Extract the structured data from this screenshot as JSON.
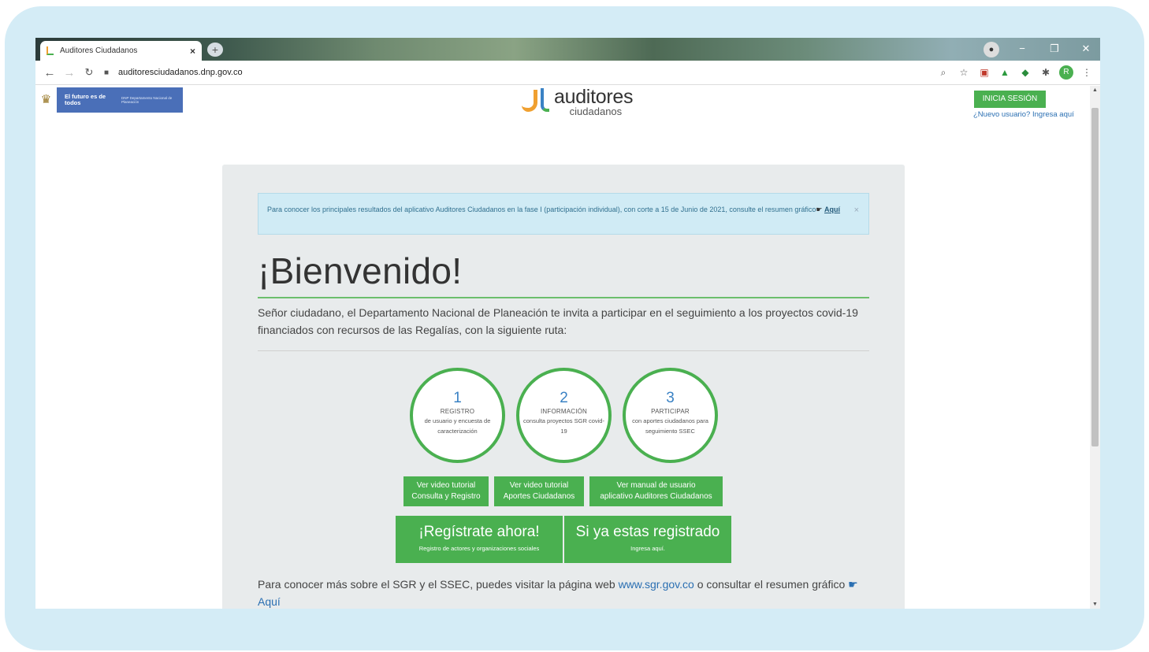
{
  "browser": {
    "tab_title": "Auditores Ciudadanos",
    "tab_close": "×",
    "new_tab": "+",
    "url": "auditoresciudadanos.dnp.gov.co",
    "window_controls": {
      "minimize": "−",
      "maximize": "❐",
      "close": "✕"
    },
    "extensions": [
      "zoom-icon",
      "star-icon",
      "pocket-icon",
      "drive-icon",
      "extension-icon",
      "puzzle-icon",
      "avatar",
      "menu-icon"
    ],
    "avatar_initial": "R"
  },
  "header": {
    "gov_tagline": "El futuro es de todos",
    "gov_dept": "DNP Departamento Nacional de Planeación",
    "brand_name": "auditores",
    "brand_sub": "ciudadanos",
    "login_label": "INICIA SESIÓN",
    "register_link": "¿Nuevo usuario? Ingresa aquí"
  },
  "alert": {
    "text": "Para conocer los principales resultados del aplicativo Auditores Ciudadanos en la fase I (participación individual), con corte a 15 de Junio de 2021, consulte el resumen gráfico",
    "link": "Aquí",
    "close": "×"
  },
  "main": {
    "welcome": "¡Bienvenido!",
    "intro": "Señor ciudadano, el Departamento Nacional de Planeación te invita a participar en el seguimiento a los proyectos covid-19 financiados con recursos de las Regalías, con la siguiente ruta:",
    "steps": [
      {
        "number": "1",
        "title": "REGISTRO",
        "desc": "de usuario y encuesta de caracterización"
      },
      {
        "number": "2",
        "title": "INFORMACIÓN",
        "desc": "consulta proyectos SGR covid-19"
      },
      {
        "number": "3",
        "title": "PARTICIPAR",
        "desc": "con aportes ciudadanos para seguimiento SSEC"
      }
    ],
    "small_buttons": [
      {
        "line1": "Ver video tutorial",
        "line2": "Consulta y Registro"
      },
      {
        "line1": "Ver video tutorial",
        "line2": "Aportes Ciudadanos"
      },
      {
        "line1": "Ver manual de usuario",
        "line2": "aplicativo Auditores Ciudadanos"
      }
    ],
    "register_now": {
      "title": "¡Regístrate ahora!",
      "sub": "Registro de actores y organizaciones sociales"
    },
    "already_registered": {
      "title": "Si ya estas registrado",
      "sub": "Ingresa aquí."
    },
    "more_text": "Para conocer más sobre el SGR y el SSEC, puedes visitar la página web",
    "more_url": "www.sgr.gov.co",
    "more_text2": "o consultar el resumen gráfico",
    "more_link": "Aquí"
  },
  "colors": {
    "accent_green": "#4ab050",
    "link_blue": "#2a6fb2",
    "alert_bg": "#d0ebf5",
    "gov_blue": "#4a6fb8",
    "frame_bg": "#d4ecf6"
  }
}
